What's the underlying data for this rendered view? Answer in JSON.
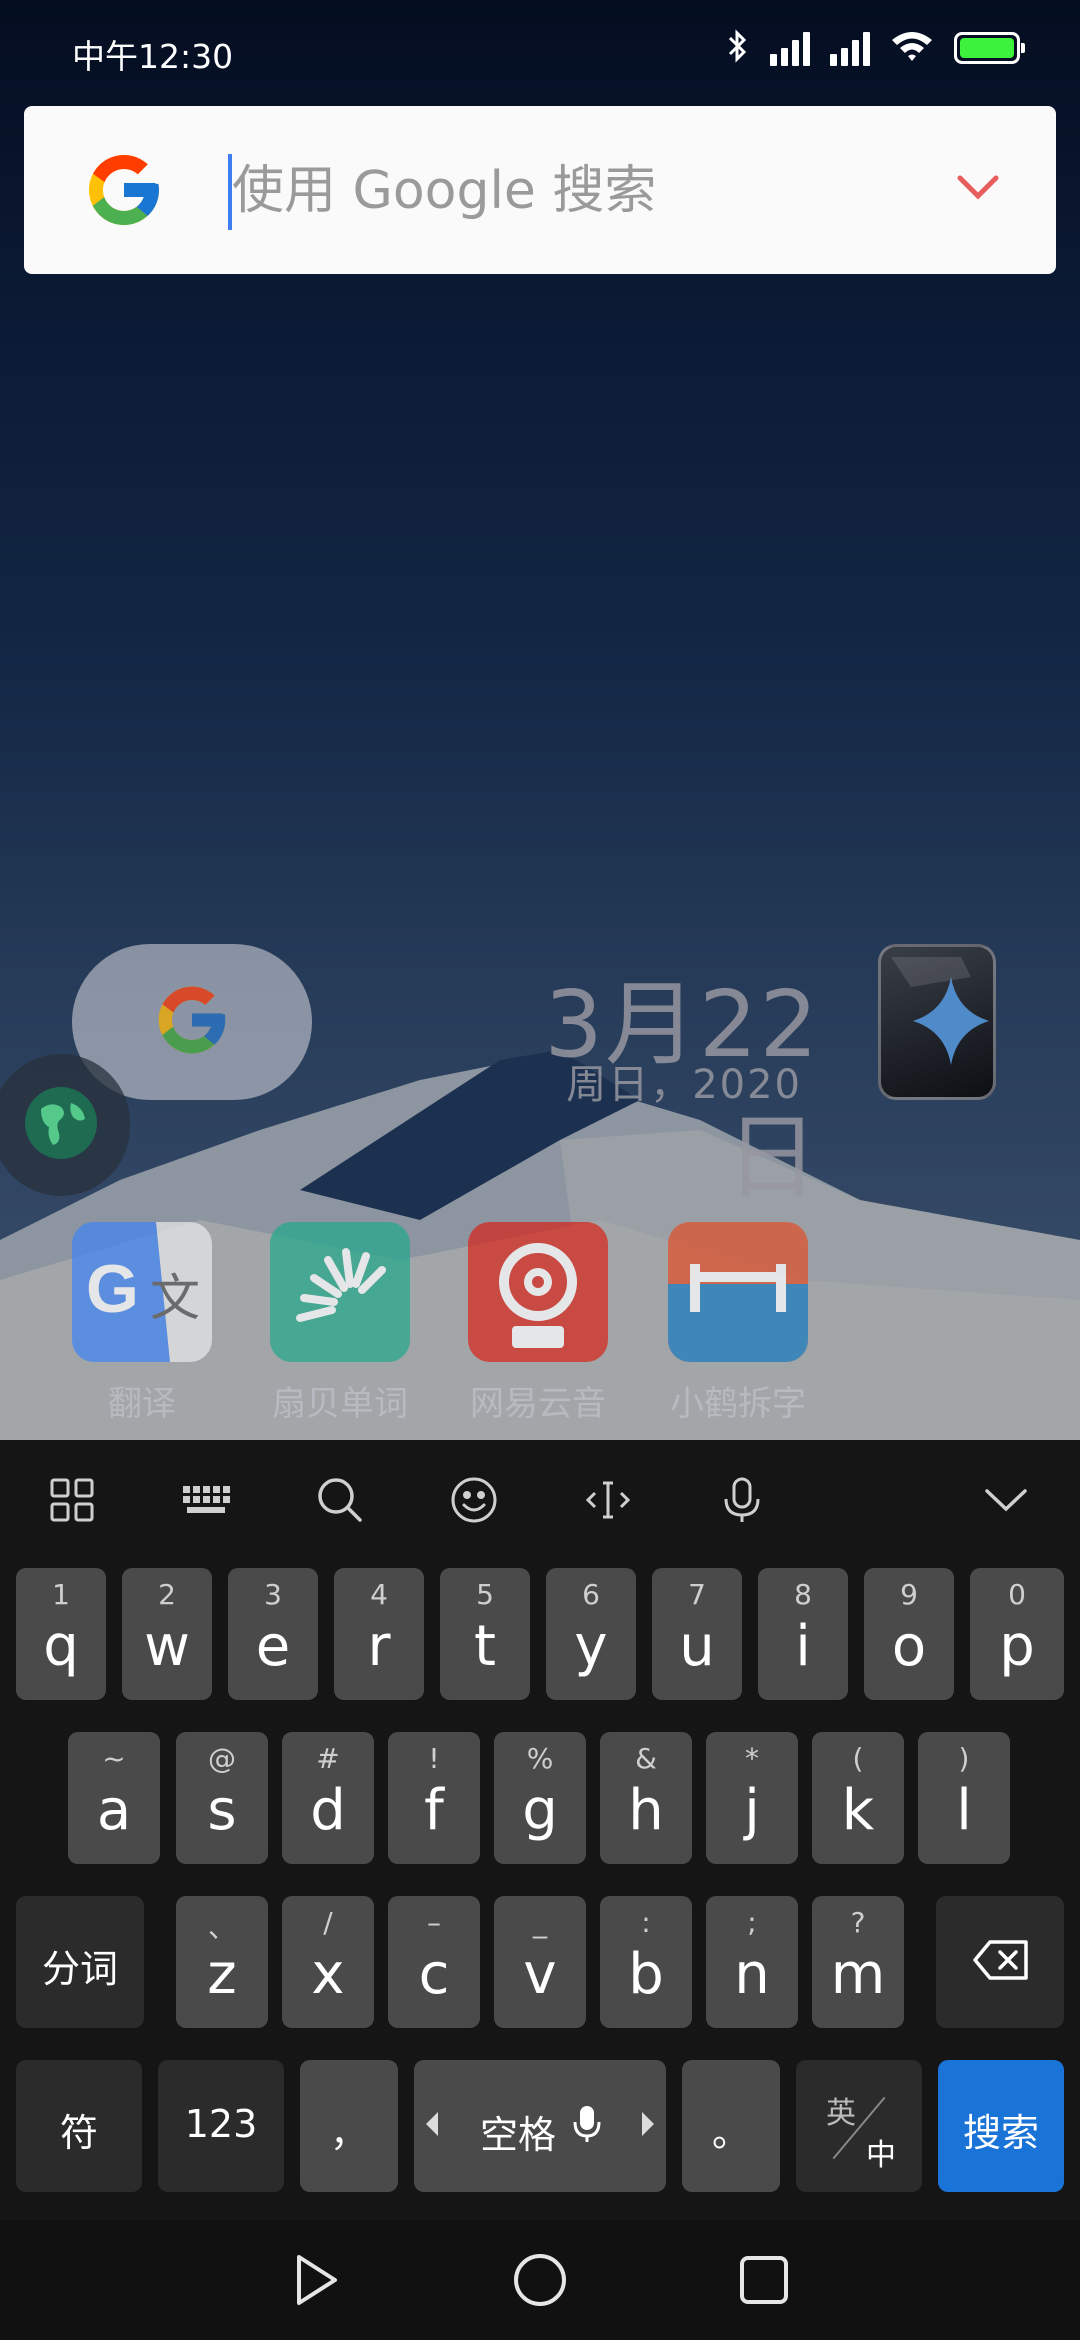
{
  "status_bar": {
    "time": "中午12:30"
  },
  "search": {
    "placeholder": "使用 Google 搜索",
    "value": ""
  },
  "clock": {
    "date": "3月22日",
    "weekday": "周日，2020"
  },
  "apps": [
    {
      "label": "翻译",
      "icon": "google-translate-icon"
    },
    {
      "label": "扇贝单词",
      "icon": "shanbay-icon"
    },
    {
      "label": "网易云音",
      "icon": "netease-music-icon"
    },
    {
      "label": "小鹤拆字",
      "icon": "xiaohe-icon"
    }
  ],
  "keyboard": {
    "row1": [
      {
        "hint": "1",
        "key": "q"
      },
      {
        "hint": "2",
        "key": "w"
      },
      {
        "hint": "3",
        "key": "e"
      },
      {
        "hint": "4",
        "key": "r"
      },
      {
        "hint": "5",
        "key": "t"
      },
      {
        "hint": "6",
        "key": "y"
      },
      {
        "hint": "7",
        "key": "u"
      },
      {
        "hint": "8",
        "key": "i"
      },
      {
        "hint": "9",
        "key": "o"
      },
      {
        "hint": "0",
        "key": "p"
      }
    ],
    "row2": [
      {
        "hint": "~",
        "key": "a"
      },
      {
        "hint": "@",
        "key": "s"
      },
      {
        "hint": "#",
        "key": "d"
      },
      {
        "hint": "!",
        "key": "f"
      },
      {
        "hint": "%",
        "key": "g"
      },
      {
        "hint": "&",
        "key": "h"
      },
      {
        "hint": "*",
        "key": "j"
      },
      {
        "hint": "(",
        "key": "k"
      },
      {
        "hint": ")",
        "key": "l"
      }
    ],
    "row3": [
      {
        "hint": "、",
        "key": "z"
      },
      {
        "hint": "/",
        "key": "x"
      },
      {
        "hint": "–",
        "key": "c"
      },
      {
        "hint": "_",
        "key": "v"
      },
      {
        "hint": ":",
        "key": "b"
      },
      {
        "hint": ";",
        "key": "n"
      },
      {
        "hint": "?",
        "key": "m"
      }
    ],
    "segment_label": "分词",
    "symbols_label": "符",
    "numbers_label": "123",
    "comma_label": "，",
    "space_label": "空格",
    "period_label": "。",
    "lang_en_label": "英",
    "lang_zh_label": "中",
    "search_label": "搜索"
  },
  "colors": {
    "accent": "#1a73d6",
    "battery": "#3cf23c",
    "chevron": "#e85d5d"
  }
}
